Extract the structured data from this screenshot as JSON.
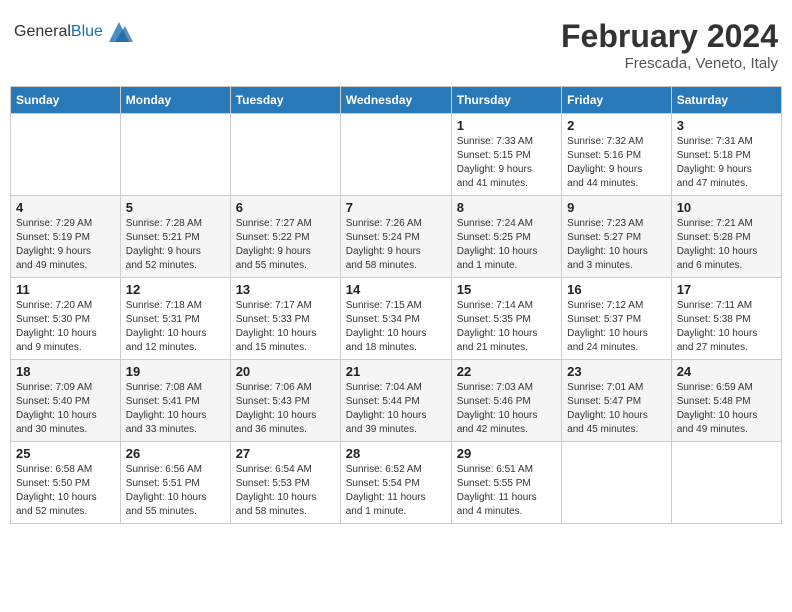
{
  "header": {
    "logo_general": "General",
    "logo_blue": "Blue",
    "title": "February 2024",
    "subtitle": "Frescada, Veneto, Italy"
  },
  "weekdays": [
    "Sunday",
    "Monday",
    "Tuesday",
    "Wednesday",
    "Thursday",
    "Friday",
    "Saturday"
  ],
  "weeks": [
    [
      {
        "day": "",
        "info": ""
      },
      {
        "day": "",
        "info": ""
      },
      {
        "day": "",
        "info": ""
      },
      {
        "day": "",
        "info": ""
      },
      {
        "day": "1",
        "info": "Sunrise: 7:33 AM\nSunset: 5:15 PM\nDaylight: 9 hours\nand 41 minutes."
      },
      {
        "day": "2",
        "info": "Sunrise: 7:32 AM\nSunset: 5:16 PM\nDaylight: 9 hours\nand 44 minutes."
      },
      {
        "day": "3",
        "info": "Sunrise: 7:31 AM\nSunset: 5:18 PM\nDaylight: 9 hours\nand 47 minutes."
      }
    ],
    [
      {
        "day": "4",
        "info": "Sunrise: 7:29 AM\nSunset: 5:19 PM\nDaylight: 9 hours\nand 49 minutes."
      },
      {
        "day": "5",
        "info": "Sunrise: 7:28 AM\nSunset: 5:21 PM\nDaylight: 9 hours\nand 52 minutes."
      },
      {
        "day": "6",
        "info": "Sunrise: 7:27 AM\nSunset: 5:22 PM\nDaylight: 9 hours\nand 55 minutes."
      },
      {
        "day": "7",
        "info": "Sunrise: 7:26 AM\nSunset: 5:24 PM\nDaylight: 9 hours\nand 58 minutes."
      },
      {
        "day": "8",
        "info": "Sunrise: 7:24 AM\nSunset: 5:25 PM\nDaylight: 10 hours\nand 1 minute."
      },
      {
        "day": "9",
        "info": "Sunrise: 7:23 AM\nSunset: 5:27 PM\nDaylight: 10 hours\nand 3 minutes."
      },
      {
        "day": "10",
        "info": "Sunrise: 7:21 AM\nSunset: 5:28 PM\nDaylight: 10 hours\nand 6 minutes."
      }
    ],
    [
      {
        "day": "11",
        "info": "Sunrise: 7:20 AM\nSunset: 5:30 PM\nDaylight: 10 hours\nand 9 minutes."
      },
      {
        "day": "12",
        "info": "Sunrise: 7:18 AM\nSunset: 5:31 PM\nDaylight: 10 hours\nand 12 minutes."
      },
      {
        "day": "13",
        "info": "Sunrise: 7:17 AM\nSunset: 5:33 PM\nDaylight: 10 hours\nand 15 minutes."
      },
      {
        "day": "14",
        "info": "Sunrise: 7:15 AM\nSunset: 5:34 PM\nDaylight: 10 hours\nand 18 minutes."
      },
      {
        "day": "15",
        "info": "Sunrise: 7:14 AM\nSunset: 5:35 PM\nDaylight: 10 hours\nand 21 minutes."
      },
      {
        "day": "16",
        "info": "Sunrise: 7:12 AM\nSunset: 5:37 PM\nDaylight: 10 hours\nand 24 minutes."
      },
      {
        "day": "17",
        "info": "Sunrise: 7:11 AM\nSunset: 5:38 PM\nDaylight: 10 hours\nand 27 minutes."
      }
    ],
    [
      {
        "day": "18",
        "info": "Sunrise: 7:09 AM\nSunset: 5:40 PM\nDaylight: 10 hours\nand 30 minutes."
      },
      {
        "day": "19",
        "info": "Sunrise: 7:08 AM\nSunset: 5:41 PM\nDaylight: 10 hours\nand 33 minutes."
      },
      {
        "day": "20",
        "info": "Sunrise: 7:06 AM\nSunset: 5:43 PM\nDaylight: 10 hours\nand 36 minutes."
      },
      {
        "day": "21",
        "info": "Sunrise: 7:04 AM\nSunset: 5:44 PM\nDaylight: 10 hours\nand 39 minutes."
      },
      {
        "day": "22",
        "info": "Sunrise: 7:03 AM\nSunset: 5:46 PM\nDaylight: 10 hours\nand 42 minutes."
      },
      {
        "day": "23",
        "info": "Sunrise: 7:01 AM\nSunset: 5:47 PM\nDaylight: 10 hours\nand 45 minutes."
      },
      {
        "day": "24",
        "info": "Sunrise: 6:59 AM\nSunset: 5:48 PM\nDaylight: 10 hours\nand 49 minutes."
      }
    ],
    [
      {
        "day": "25",
        "info": "Sunrise: 6:58 AM\nSunset: 5:50 PM\nDaylight: 10 hours\nand 52 minutes."
      },
      {
        "day": "26",
        "info": "Sunrise: 6:56 AM\nSunset: 5:51 PM\nDaylight: 10 hours\nand 55 minutes."
      },
      {
        "day": "27",
        "info": "Sunrise: 6:54 AM\nSunset: 5:53 PM\nDaylight: 10 hours\nand 58 minutes."
      },
      {
        "day": "28",
        "info": "Sunrise: 6:52 AM\nSunset: 5:54 PM\nDaylight: 11 hours\nand 1 minute."
      },
      {
        "day": "29",
        "info": "Sunrise: 6:51 AM\nSunset: 5:55 PM\nDaylight: 11 hours\nand 4 minutes."
      },
      {
        "day": "",
        "info": ""
      },
      {
        "day": "",
        "info": ""
      }
    ]
  ]
}
